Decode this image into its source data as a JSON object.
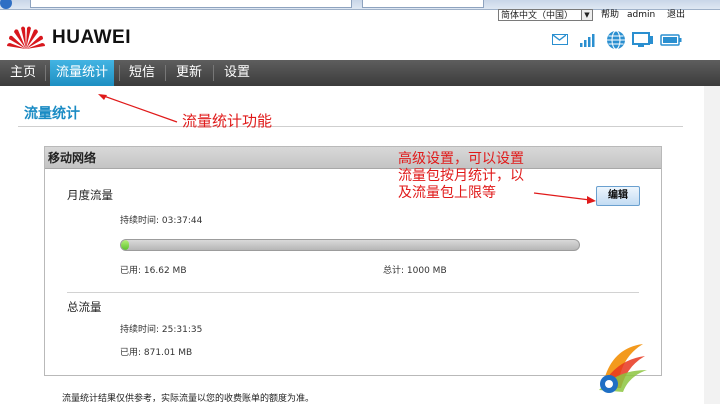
{
  "top_bar": {
    "language": "简体中文（中国）",
    "help": "帮助",
    "user": "admin",
    "logout": "退出"
  },
  "brand": {
    "name": "HUAWEI"
  },
  "status_icons": [
    "mail-icon",
    "signal-icon",
    "globe-icon",
    "monitor-icon",
    "battery-icon"
  ],
  "nav": {
    "items": [
      {
        "label": "主页"
      },
      {
        "label": "流量统计"
      },
      {
        "label": "短信"
      },
      {
        "label": "更新"
      },
      {
        "label": "设置"
      }
    ],
    "active_index": 1
  },
  "page": {
    "title": "流量统计"
  },
  "annotations": {
    "feature": "流量统计功能",
    "settings_lines": [
      "高级设置，可以设置",
      "流量包按月统计，以",
      "及流量包上限等"
    ]
  },
  "panel": {
    "title": "移动网络",
    "monthly": {
      "label": "月度流量",
      "duration_label": "持续时间:",
      "duration": "03:37:44",
      "used_label": "已用:",
      "used": "16.62 MB",
      "total_label": "总计:",
      "total": "1000 MB",
      "used_fraction": 0.0166
    },
    "edit_button": "编辑",
    "total_traffic": {
      "label": "总流量",
      "duration_label": "持续时间:",
      "duration": "25:31:35",
      "used_label": "已用:",
      "used": "871.01 MB"
    }
  },
  "footnote": "流量统计结果仅供参考，实际流量以您的收费账单的额度为准。",
  "colors": {
    "accent": "#1d8fc2",
    "annotation": "#e01a1a",
    "progress": "#5cc22c",
    "logo": "#d8171d"
  }
}
